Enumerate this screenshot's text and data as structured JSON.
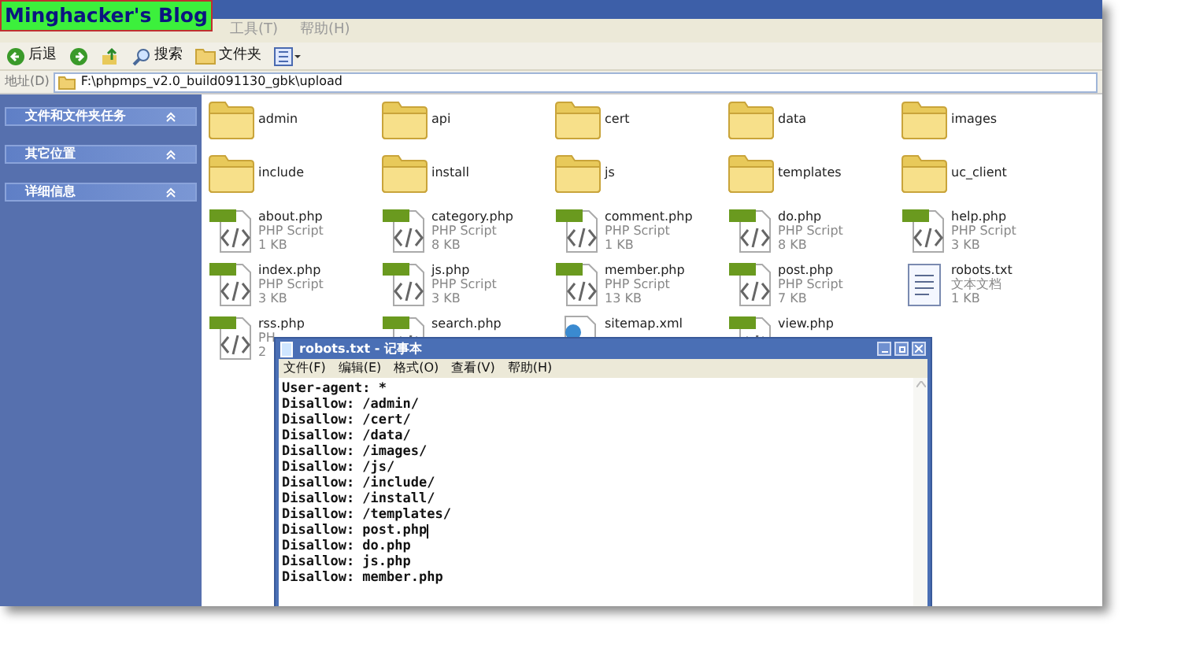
{
  "banner": {
    "title": "Minghacker's Blog"
  },
  "menu": [
    {
      "label": "工具(T)"
    },
    {
      "label": "帮助(H)"
    }
  ],
  "toolbar": [
    {
      "kind": "back",
      "label": "后退"
    },
    {
      "kind": "forward"
    },
    {
      "kind": "up"
    },
    {
      "kind": "search",
      "label": "搜索"
    },
    {
      "kind": "folders",
      "label": "文件夹"
    },
    {
      "kind": "views"
    }
  ],
  "address": {
    "label": "地址(D)",
    "value": "F:\\phpmps_v2.0_build091130_gbk\\upload"
  },
  "sidebar": {
    "sections": [
      {
        "title": "文件和文件夹任务",
        "expanded": true
      },
      {
        "title": "其它位置",
        "expanded": true
      },
      {
        "title": "详细信息",
        "expanded": true
      }
    ]
  },
  "files": [
    {
      "kind": "folder",
      "name": "admin"
    },
    {
      "kind": "folder",
      "name": "api"
    },
    {
      "kind": "folder",
      "name": "cert"
    },
    {
      "kind": "folder",
      "name": "data"
    },
    {
      "kind": "folder",
      "name": "images"
    },
    {
      "kind": "folder",
      "name": "include"
    },
    {
      "kind": "folder",
      "name": "install"
    },
    {
      "kind": "folder",
      "name": "js"
    },
    {
      "kind": "folder",
      "name": "templates"
    },
    {
      "kind": "folder",
      "name": "uc_client"
    },
    {
      "kind": "php",
      "name": "about.php",
      "type": "PHP Script",
      "size": "1 KB"
    },
    {
      "kind": "php",
      "name": "category.php",
      "type": "PHP Script",
      "size": "8 KB"
    },
    {
      "kind": "php",
      "name": "comment.php",
      "type": "PHP Script",
      "size": "1 KB"
    },
    {
      "kind": "php",
      "name": "do.php",
      "type": "PHP Script",
      "size": "8 KB"
    },
    {
      "kind": "php",
      "name": "help.php",
      "type": "PHP Script",
      "size": "3 KB"
    },
    {
      "kind": "php",
      "name": "index.php",
      "type": "PHP Script",
      "size": "3 KB"
    },
    {
      "kind": "php",
      "name": "js.php",
      "type": "PHP Script",
      "size": "3 KB"
    },
    {
      "kind": "php",
      "name": "member.php",
      "type": "PHP Script",
      "size": "13 KB"
    },
    {
      "kind": "php",
      "name": "post.php",
      "type": "PHP Script",
      "size": "7 KB"
    },
    {
      "kind": "text",
      "name": "robots.txt",
      "type": "文本文档",
      "size": "1 KB"
    },
    {
      "kind": "php",
      "name": "rss.php",
      "type": "PH",
      "size": "2"
    },
    {
      "kind": "php",
      "name": "search.php",
      "icon_covered": true
    },
    {
      "kind": "xml",
      "name": "sitemap.xml",
      "icon_covered": true
    },
    {
      "kind": "php",
      "name": "view.php",
      "icon_covered": true
    }
  ],
  "notepad": {
    "title": "robots.txt - 记事本",
    "menu": [
      "文件(F)",
      "编辑(E)",
      "格式(O)",
      "查看(V)",
      "帮助(H)"
    ],
    "lines": [
      {
        "text": "User-agent: *",
        "cursor": false
      },
      {
        "text": "Disallow: /admin/",
        "cursor": false
      },
      {
        "text": "Disallow: /cert/",
        "cursor": false
      },
      {
        "text": "Disallow: /data/",
        "cursor": false
      },
      {
        "text": "Disallow: /images/",
        "cursor": false
      },
      {
        "text": "Disallow: /js/",
        "cursor": false
      },
      {
        "text": "Disallow: /include/",
        "cursor": false
      },
      {
        "text": "Disallow: /install/",
        "cursor": false
      },
      {
        "text": "Disallow: /templates/",
        "cursor": false
      },
      {
        "text": "Disallow: post.php",
        "cursor": true
      },
      {
        "text": "Disallow: do.php",
        "cursor": false
      },
      {
        "text": "Disallow: js.php",
        "cursor": false
      },
      {
        "text": "Disallow: member.php",
        "cursor": false
      }
    ]
  }
}
